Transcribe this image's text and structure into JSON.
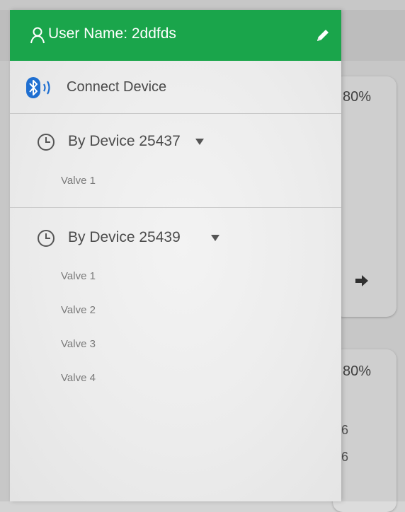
{
  "background": {
    "card1_percent": "80%",
    "card2_percent": "80%",
    "card2_fragments": [
      "6",
      "6"
    ]
  },
  "drawer": {
    "user_name_label": "User Name: 2ddfds",
    "connect_label": "Connect Device",
    "groups": [
      {
        "label": "By Device 25437",
        "valves": [
          "Valve 1"
        ]
      },
      {
        "label": "By Device 25439",
        "valves": [
          "Valve 1",
          "Valve 2",
          "Valve 3",
          "Valve 4"
        ]
      }
    ]
  },
  "colors": {
    "header_green": "#1aa54b",
    "bluetooth_blue": "#1f6fd1"
  },
  "icons": [
    "user-icon",
    "edit-pencil-icon",
    "bluetooth-icon",
    "clock-icon",
    "caret-down-icon",
    "arrow-right-icon"
  ]
}
